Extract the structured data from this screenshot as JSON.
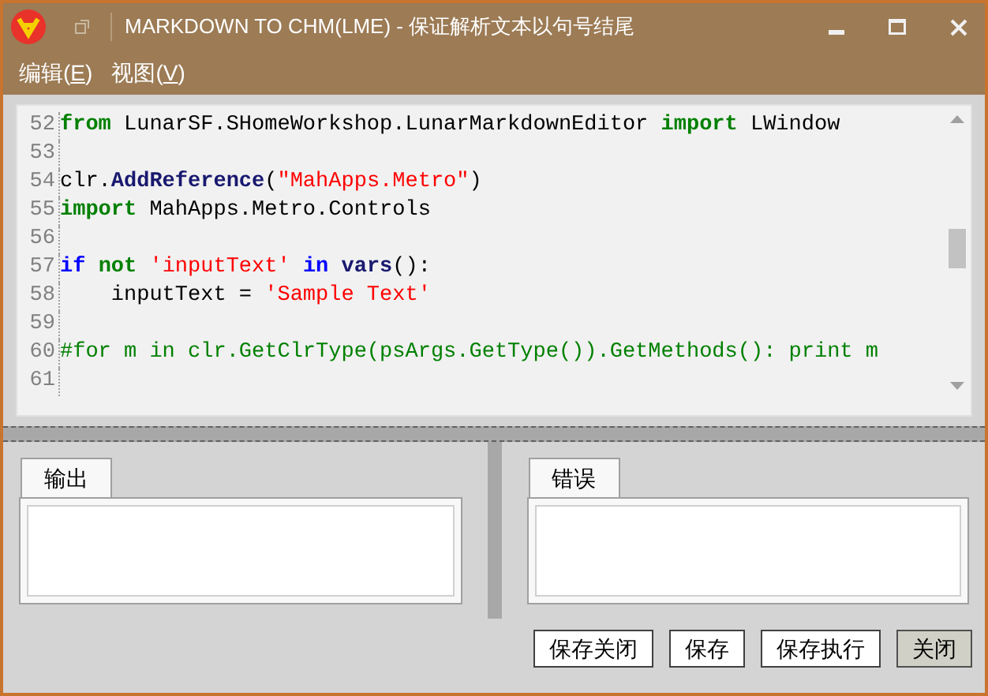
{
  "window": {
    "title": "MARKDOWN TO CHM(LME) - 保证解析文本以句号结尾"
  },
  "menu": [
    {
      "label": "编辑(",
      "key": "E",
      "end": ")"
    },
    {
      "label": "视图(",
      "key": "V",
      "end": ")"
    }
  ],
  "editor": {
    "lines": [
      {
        "number": "52",
        "tokens": [
          {
            "kind": "kw",
            "text": "from"
          },
          {
            "kind": "plain",
            "text": " LunarSF.SHomeWorkshop.LunarMarkdownEditor "
          },
          {
            "kind": "kw",
            "text": "import"
          },
          {
            "kind": "plain",
            "text": " LWindow"
          }
        ]
      },
      {
        "number": "53"
      },
      {
        "number": "54",
        "tokens": [
          {
            "kind": "plain",
            "text": "clr."
          },
          {
            "kind": "fn",
            "text": "AddReference"
          },
          {
            "kind": "plain",
            "text": "("
          },
          {
            "kind": "str",
            "text": "\"MahApps.Metro\""
          },
          {
            "kind": "plain",
            "text": ")"
          }
        ]
      },
      {
        "number": "55",
        "tokens": [
          {
            "kind": "kw",
            "text": "import"
          },
          {
            "kind": "plain",
            "text": " MahApps.Metro.Controls"
          }
        ]
      },
      {
        "number": "56"
      },
      {
        "number": "57",
        "tokens": [
          {
            "kind": "kw2",
            "text": "if "
          },
          {
            "kind": "kw",
            "text": "not "
          },
          {
            "kind": "str",
            "text": "'inputText' "
          },
          {
            "kind": "kw2",
            "text": "in "
          },
          {
            "kind": "fn",
            "text": "vars"
          },
          {
            "kind": "plain",
            "text": "():"
          }
        ]
      },
      {
        "number": "58",
        "tokens": [
          {
            "kind": "plain",
            "text": "    inputText = "
          },
          {
            "kind": "str",
            "text": "'Sample Text'"
          }
        ]
      },
      {
        "number": "59"
      },
      {
        "number": "60",
        "tokens": [
          {
            "kind": "comment",
            "text": "#for m in clr.GetClrType(psArgs.GetType()).GetMethods(): print m"
          }
        ]
      },
      {
        "number": "61"
      }
    ]
  },
  "panels": [
    {
      "tab": "输出"
    },
    {
      "tab": "错误"
    }
  ],
  "buttons": [
    {
      "label": "保存关闭",
      "default": false
    },
    {
      "label": "保存",
      "default": false
    },
    {
      "label": "保存执行",
      "default": false
    },
    {
      "label": "关闭",
      "default": true
    }
  ]
}
